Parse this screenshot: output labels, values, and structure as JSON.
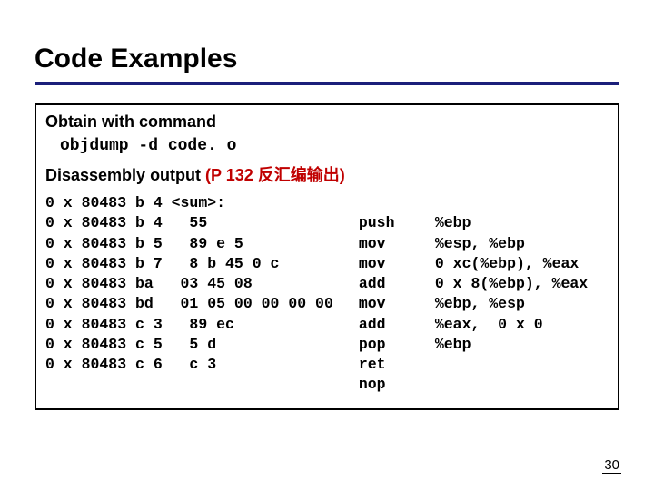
{
  "title": "Code Examples",
  "section": {
    "obtain_label": "Obtain with command",
    "command": "objdump -d code. o",
    "disasm_label_prefix": "Disassembly output ",
    "disasm_label_note": "(P 132 反汇编输出)"
  },
  "disasm": {
    "col_addr_bytes": "0 x 80483 b 4 <sum>:\n0 x 80483 b 4   55\n0 x 80483 b 5   89 e 5\n0 x 80483 b 7   8 b 45 0 c\n0 x 80483 ba   03 45 08\n0 x 80483 bd   01 05 00 00 00 00\n0 x 80483 c 3   89 ec\n0 x 80483 c 5   5 d\n0 x 80483 c 6   c 3",
    "col_mnemonic": "\npush\nmov\nmov\nadd\nmov\nadd\npop\nret\nnop",
    "col_operands": "\n%ebp\n%esp, %ebp\n0 xc(%ebp), %eax\n0 x 8(%ebp), %eax\n%ebp, %esp\n%eax,  0 x 0\n%ebp"
  },
  "page_number": "30"
}
